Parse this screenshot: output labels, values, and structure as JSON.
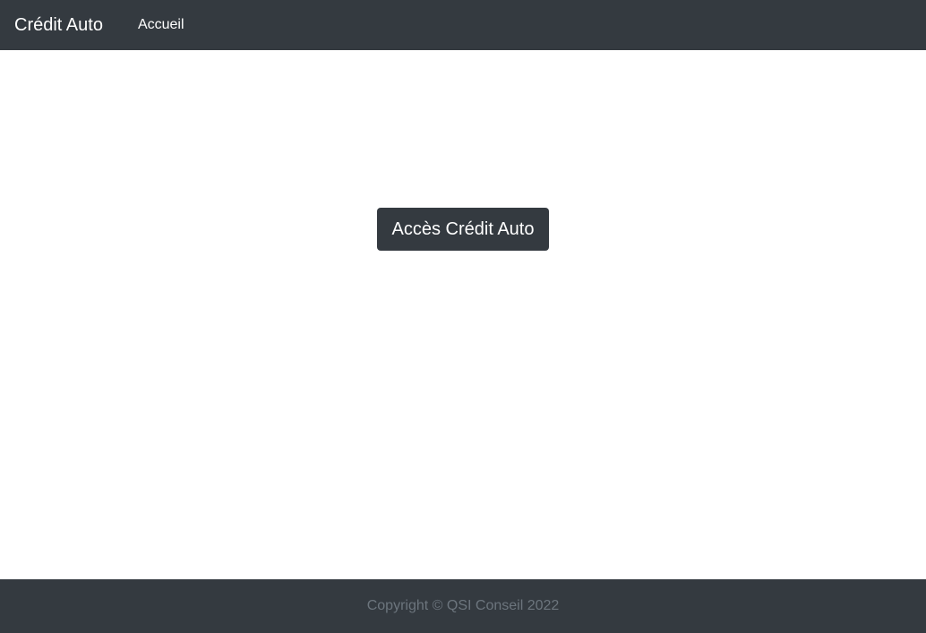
{
  "navbar": {
    "brand": "Crédit Auto",
    "links": [
      {
        "label": "Accueil"
      }
    ],
    "background": "#343a40"
  },
  "main": {
    "cta_label": "Accès Crédit Auto",
    "cta_color": "#343a40"
  },
  "footer": {
    "copyright": "Copyright © QSI Conseil 2022",
    "text_color": "#6c757d"
  }
}
